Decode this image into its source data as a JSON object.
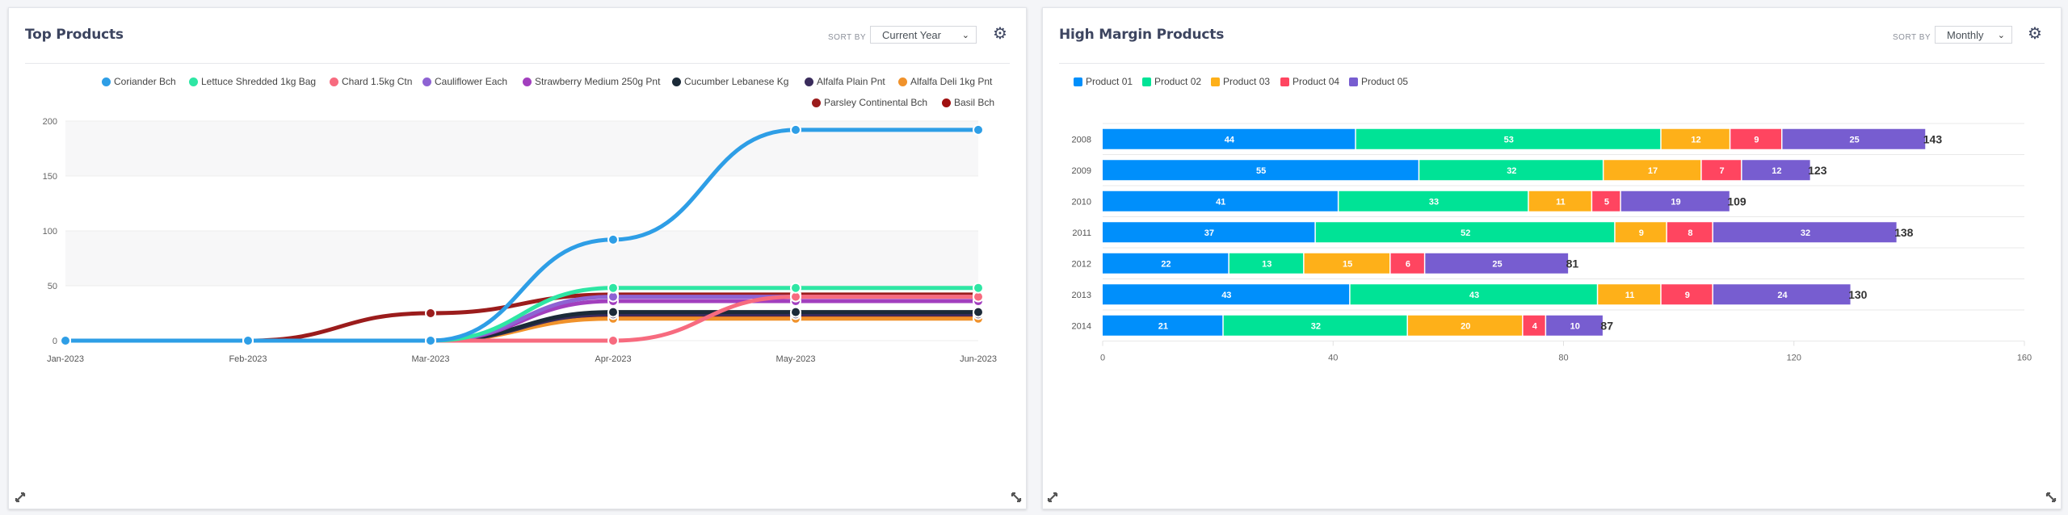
{
  "panels": {
    "top_products": {
      "title": "Top Products",
      "sort_by_label": "SORT BY",
      "sort_selected": "Current Year",
      "settings_icon": "gear-icon",
      "expand_icon": "expand-icon",
      "collapse_icon": "resize-icon"
    },
    "high_margin": {
      "title": "High Margin Products",
      "sort_by_label": "SORT BY",
      "sort_selected": "Monthly",
      "settings_icon": "gear-icon",
      "expand_icon": "expand-icon",
      "collapse_icon": "resize-icon"
    }
  },
  "chart_data": [
    {
      "type": "line",
      "title": "Top Products",
      "x": [
        "Jan-2023",
        "Feb-2023",
        "Mar-2023",
        "Apr-2023",
        "May-2023",
        "Jun-2023"
      ],
      "ylim": [
        0,
        200
      ],
      "yticks": [
        0,
        50,
        100,
        150,
        200
      ],
      "grid": true,
      "legend": "top",
      "series": [
        {
          "name": "Coriander Bch",
          "color": "#2e9ee6",
          "values": [
            0,
            0,
            0,
            92,
            192,
            192
          ]
        },
        {
          "name": "Lettuce Shredded 1kg Bag",
          "color": "#2ee6a4",
          "values": [
            0,
            0,
            0,
            48,
            48,
            48
          ]
        },
        {
          "name": "Chard 1.5kg Ctn",
          "color": "#f76b7f",
          "values": [
            0,
            0,
            0,
            0,
            40,
            40
          ]
        },
        {
          "name": "Cauliflower Each",
          "color": "#8e63d3",
          "values": [
            0,
            0,
            0,
            40,
            40,
            40
          ]
        },
        {
          "name": "Strawberry Medium 250g Pnt",
          "color": "#a23fbe",
          "values": [
            0,
            0,
            0,
            36,
            36,
            36
          ]
        },
        {
          "name": "Cucumber Lebanese Kg",
          "color": "#1b2a38",
          "values": [
            0,
            0,
            0,
            26,
            26,
            26
          ]
        },
        {
          "name": "Alfalfa Plain Pnt",
          "color": "#3a2c5c",
          "values": [
            0,
            0,
            0,
            24,
            24,
            24
          ]
        },
        {
          "name": "Alfalfa Deli 1kg Pnt",
          "color": "#f0922b",
          "values": [
            0,
            0,
            0,
            20,
            20,
            20
          ]
        },
        {
          "name": "Parsley Continental Bch",
          "color": "#9b1c1c",
          "values": [
            0,
            0,
            25,
            42,
            42,
            42
          ]
        },
        {
          "name": "Basil Bch",
          "color": "#a01010",
          "values": [
            0,
            0,
            0,
            21,
            21,
            21
          ]
        }
      ]
    },
    {
      "type": "bar",
      "orientation": "horizontal",
      "stacked": true,
      "title": "High Margin Products",
      "categories": [
        "2008",
        "2009",
        "2010",
        "2011",
        "2012",
        "2013",
        "2014"
      ],
      "xlim": [
        0,
        160
      ],
      "xticks": [
        0,
        40,
        80,
        120,
        160
      ],
      "grid": true,
      "legend": "top-left",
      "series": [
        {
          "name": "Product 01",
          "color": "#008ffb",
          "values": [
            44,
            55,
            41,
            37,
            22,
            43,
            21
          ]
        },
        {
          "name": "Product 02",
          "color": "#00e396",
          "values": [
            53,
            32,
            33,
            52,
            13,
            43,
            32
          ]
        },
        {
          "name": "Product 03",
          "color": "#feb019",
          "values": [
            12,
            17,
            11,
            9,
            15,
            11,
            20
          ]
        },
        {
          "name": "Product 04",
          "color": "#ff4560",
          "values": [
            9,
            7,
            5,
            8,
            6,
            9,
            4
          ]
        },
        {
          "name": "Product 05",
          "color": "#775dd0",
          "values": [
            25,
            12,
            19,
            32,
            25,
            24,
            10
          ]
        }
      ],
      "totals": [
        143,
        123,
        109,
        138,
        81,
        130,
        87
      ]
    }
  ]
}
